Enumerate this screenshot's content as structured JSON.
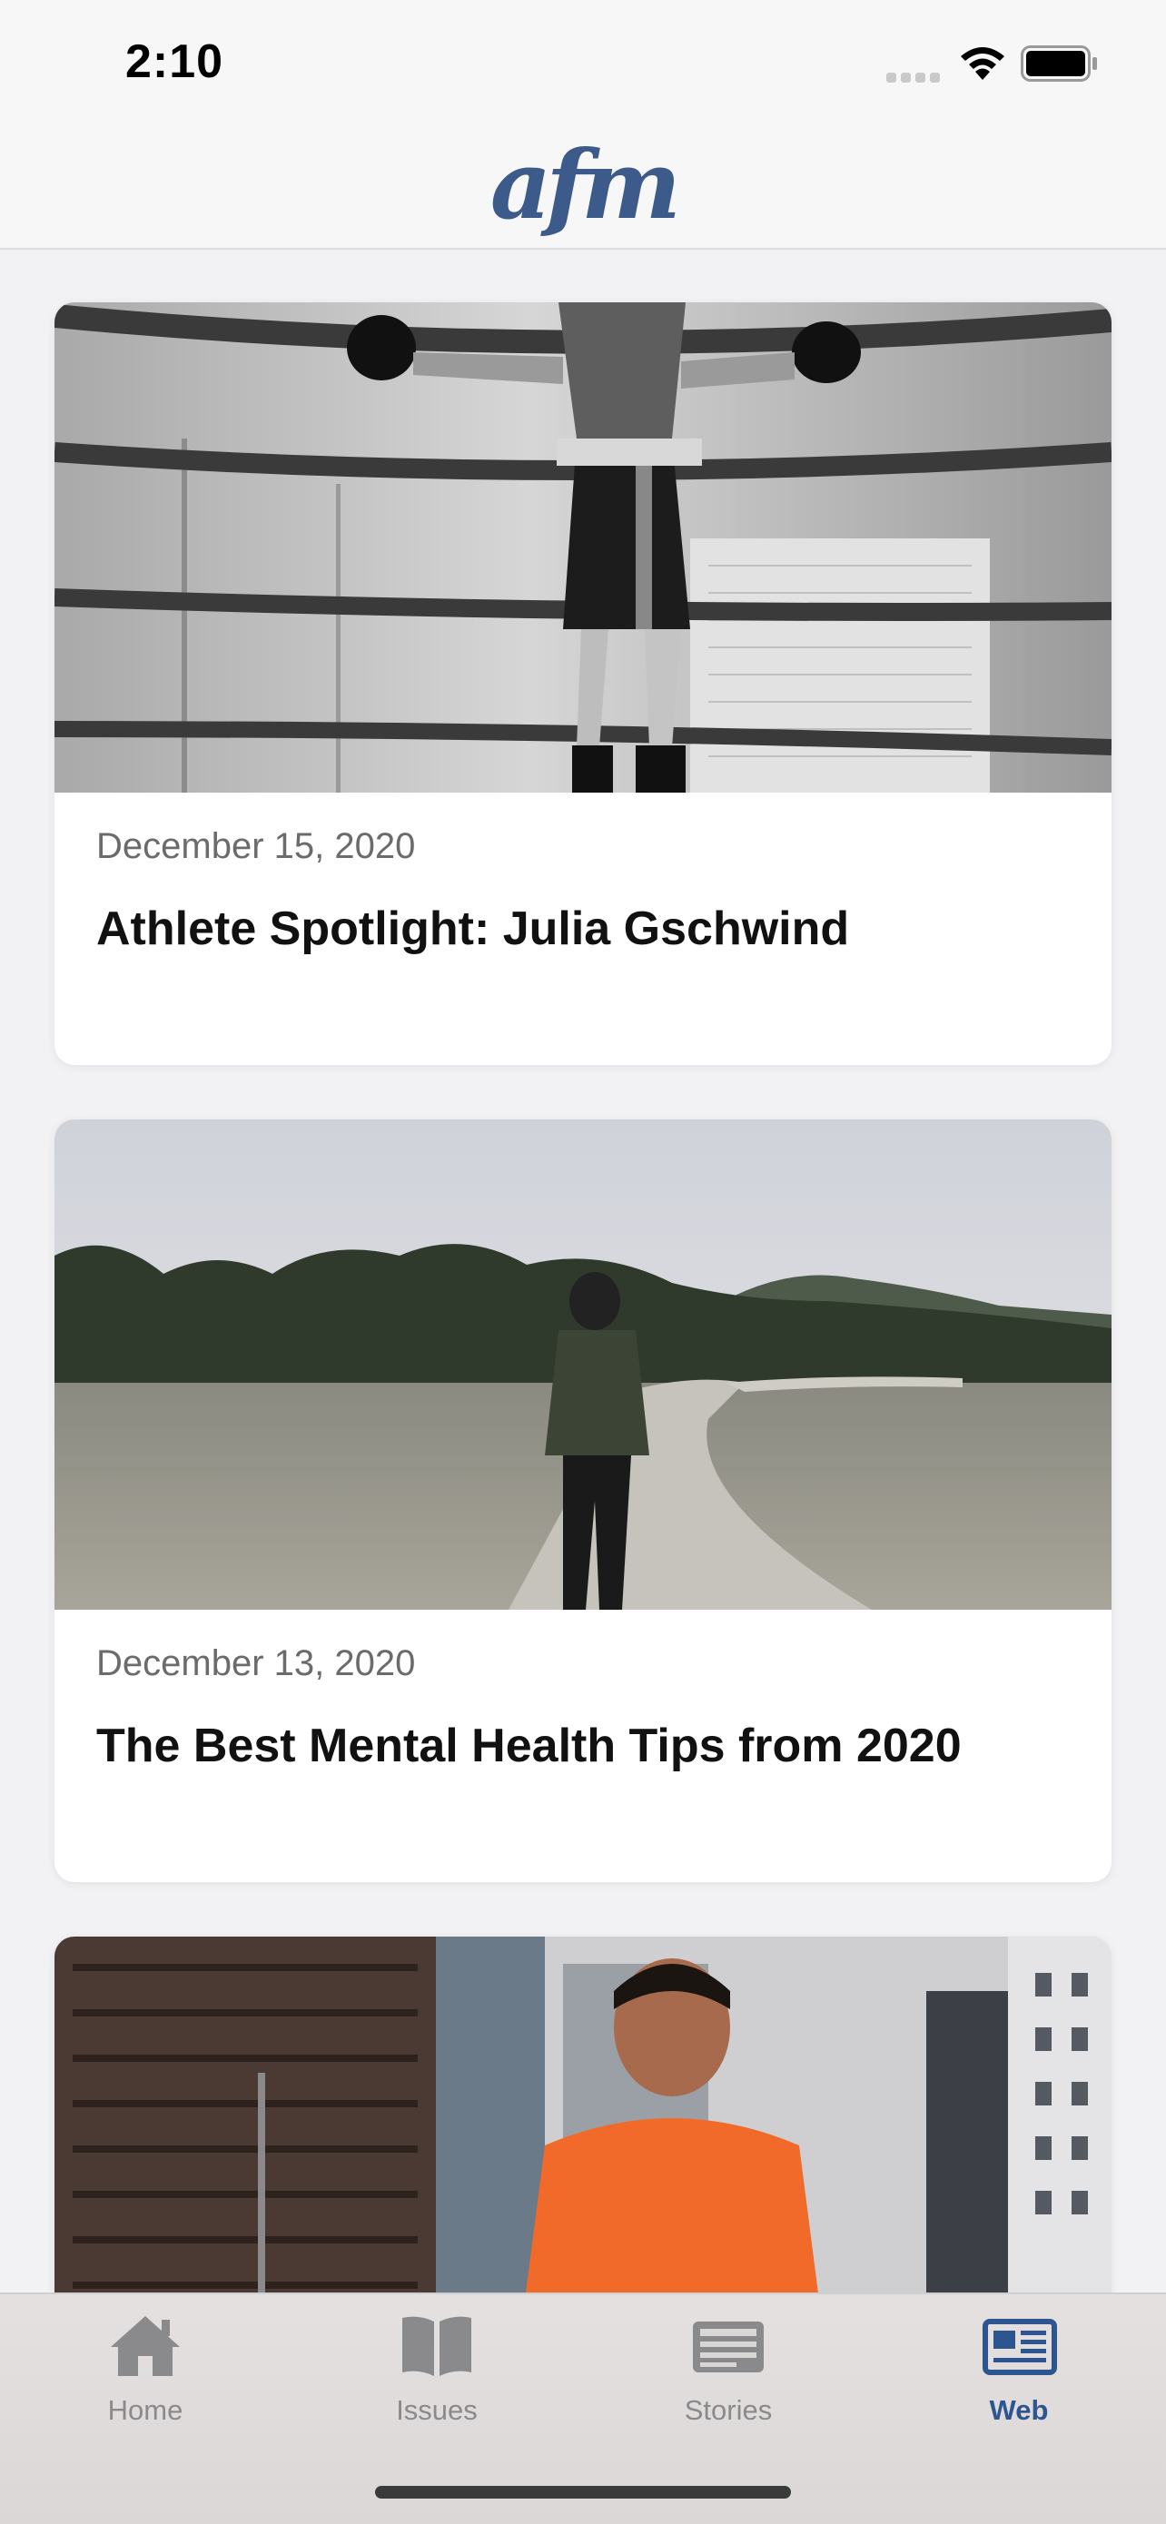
{
  "status_bar": {
    "time": "2:10"
  },
  "header": {
    "logo": "afm"
  },
  "feed": {
    "cards": [
      {
        "date": "December 15, 2020",
        "title": "Athlete Spotlight: Julia Gschwind",
        "image": "boxer-in-ring-photo"
      },
      {
        "date": "December 13, 2020",
        "title": "The Best Mental Health Tips from 2020",
        "image": "man-walking-on-trail-photo"
      },
      {
        "date": "",
        "title": "",
        "image": "smiling-man-orange-shirt-city-photo"
      }
    ]
  },
  "tab_bar": {
    "tabs": [
      {
        "label": "Home",
        "icon": "home-icon"
      },
      {
        "label": "Issues",
        "icon": "book-icon"
      },
      {
        "label": "Stories",
        "icon": "newspaper-icon"
      },
      {
        "label": "Web",
        "icon": "web-news-icon",
        "active": true
      }
    ],
    "active_color": "#2d5690",
    "inactive_color": "#8a8a8d"
  }
}
